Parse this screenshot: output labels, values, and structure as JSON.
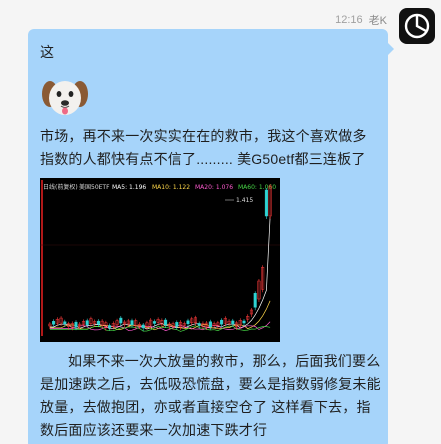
{
  "header": {
    "time": "12:16",
    "sender": "老K"
  },
  "message": {
    "line1": "这",
    "emoji": "dog-emoji",
    "para1": "市场，再不来一次实实在在的救市，我这个喜欢做多指数的人都快有点不信了.........    美G50etf都三连板了",
    "para2": "如果不来一次大放量的救市，那么，后面我们要么是加速跌之后，去低吸恐慌盘，要么是指数弱修复未能放量，去做抱团，亦或者直接空仓了         这样看下去，指数后面应该还要来一次加速下跌才行"
  },
  "chart": {
    "header_left": "日线(前复权)",
    "name": "美国50ETF",
    "ma_labels": [
      {
        "label": "MA5: 1.196",
        "color": "#ffffff"
      },
      {
        "label": "MA10: 1.122",
        "color": "#ffd84a"
      },
      {
        "label": "MA20: 1.076",
        "color": "#ff5ad0"
      },
      {
        "label": "MA60: 1.060",
        "color": "#46d646"
      }
    ],
    "peak_label": "1.415",
    "background": "#000000"
  }
}
